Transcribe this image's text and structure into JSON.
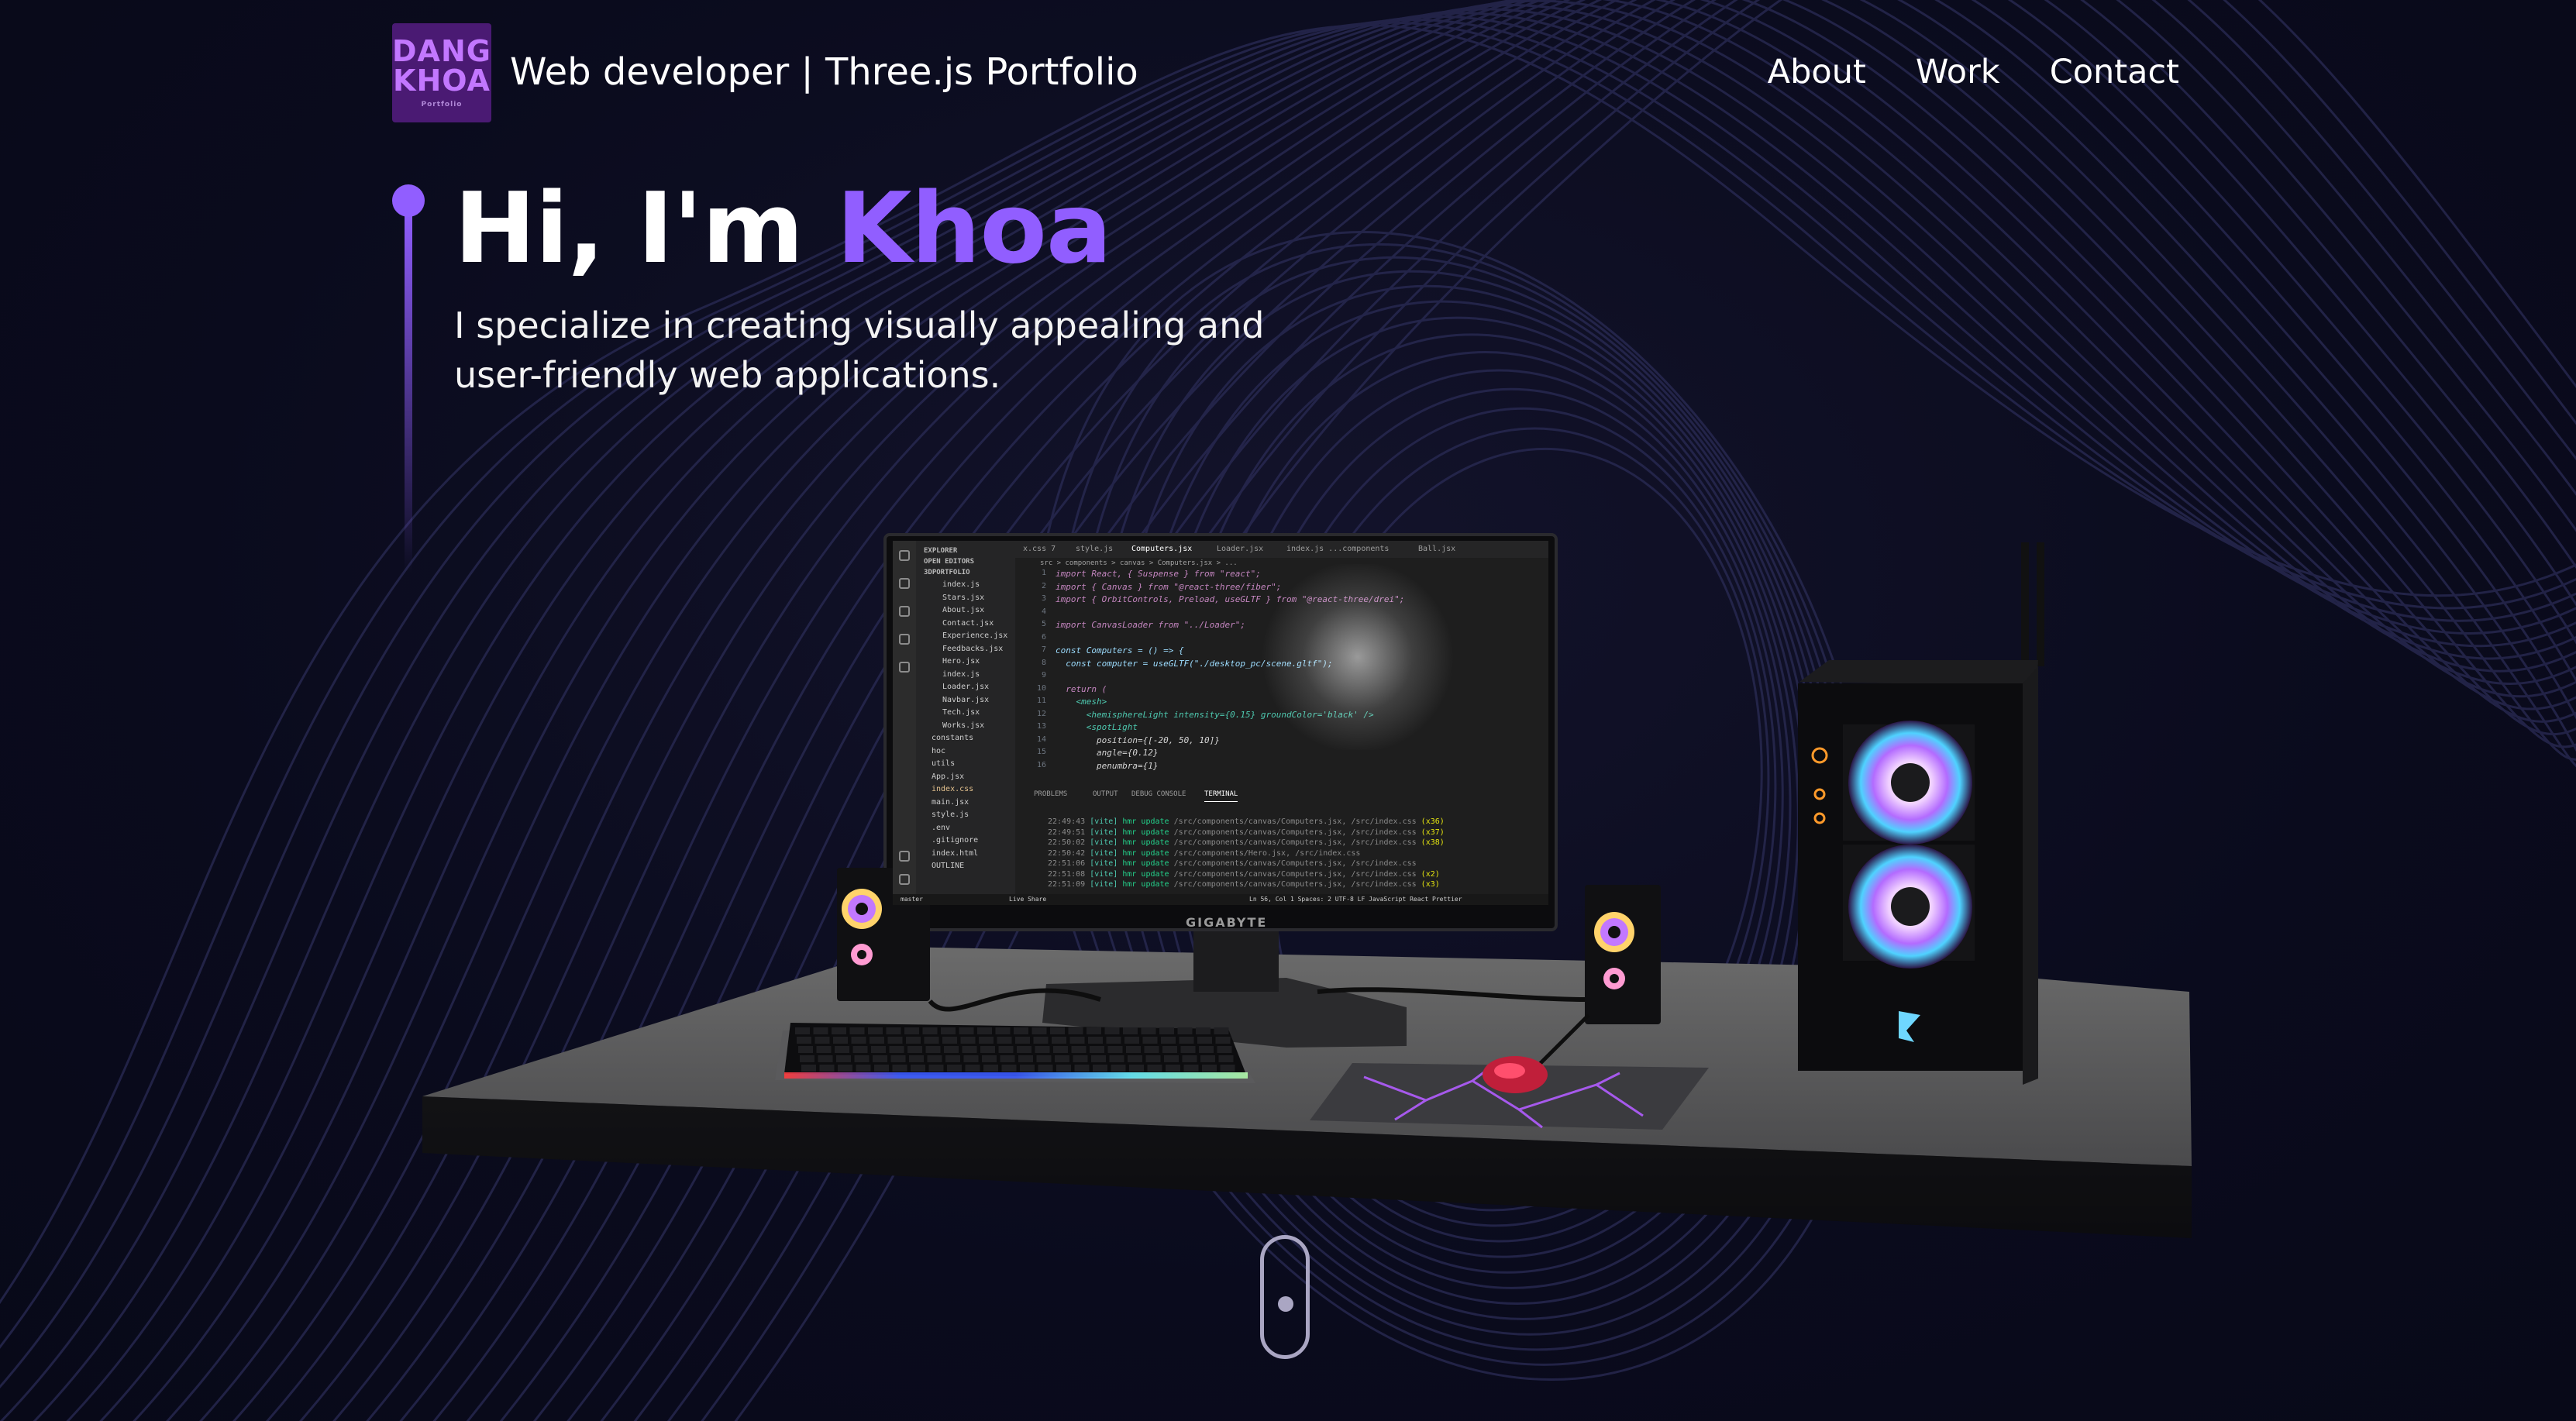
{
  "navbar": {
    "logo_line1": "DANG",
    "logo_line2": "KHOA",
    "logo_small": "Portfolio",
    "site_title": "Web developer | Three.js Portfolio",
    "links": [
      {
        "label": "About"
      },
      {
        "label": "Work"
      },
      {
        "label": "Contact"
      }
    ]
  },
  "hero": {
    "greeting": "Hi, I'm ",
    "name": "Khoa",
    "subtitle": "I specialize in creating visually appealing and user-friendly web applications."
  },
  "scene": {
    "monitor_brand": "GIGABYTE",
    "editor": {
      "tabs": [
        {
          "label": "x.css 7",
          "active": false
        },
        {
          "label": "style.js",
          "active": false
        },
        {
          "label": "Computers.jsx",
          "active": true
        },
        {
          "label": "Loader.jsx",
          "active": false
        },
        {
          "label": "index.js ...components",
          "active": false
        },
        {
          "label": "Ball.jsx",
          "active": false
        }
      ],
      "breadcrumb": "src > components > canvas > Computers.jsx > ...",
      "explorer_header": "EXPLORER",
      "open_editors": "OPEN EDITORS",
      "project": "3DPORTFOLIO",
      "files": [
        "index.js",
        "Stars.jsx",
        "About.jsx",
        "Contact.jsx",
        "Experience.jsx",
        "Feedbacks.jsx",
        "Hero.jsx",
        "index.js",
        "Loader.jsx",
        "Navbar.jsx",
        "Tech.jsx",
        "Works.jsx",
        "constants",
        "hoc",
        "utils",
        "App.jsx",
        "index.css",
        "main.jsx",
        "style.js",
        ".env",
        ".gitignore",
        "index.html",
        "OUTLINE"
      ],
      "code_lines": [
        {
          "n": "1",
          "text": "import React, { Suspense } from \"react\";"
        },
        {
          "n": "2",
          "text": "import { Canvas } from \"@react-three/fiber\";"
        },
        {
          "n": "3",
          "text": "import { OrbitControls, Preload, useGLTF } from \"@react-three/drei\";"
        },
        {
          "n": "4",
          "text": ""
        },
        {
          "n": "5",
          "text": "import CanvasLoader from \"../Loader\";"
        },
        {
          "n": "6",
          "text": ""
        },
        {
          "n": "7",
          "text": "const Computers = () => {"
        },
        {
          "n": "8",
          "text": "  const computer = useGLTF(\"./desktop_pc/scene.gltf\");"
        },
        {
          "n": "9",
          "text": ""
        },
        {
          "n": "10",
          "text": "  return ("
        },
        {
          "n": "11",
          "text": "    <mesh>"
        },
        {
          "n": "12",
          "text": "      <hemisphereLight intensity={0.15} groundColor='black' />"
        },
        {
          "n": "13",
          "text": "      <spotLight"
        },
        {
          "n": "14",
          "text": "        position={[-20, 50, 10]}"
        },
        {
          "n": "15",
          "text": "        angle={0.12}"
        },
        {
          "n": "16",
          "text": "        penumbra={1}"
        }
      ],
      "panel_tabs": [
        {
          "label": "PROBLEMS",
          "active": false
        },
        {
          "label": "OUTPUT",
          "active": false
        },
        {
          "label": "DEBUG CONSOLE",
          "active": false
        },
        {
          "label": "TERMINAL",
          "active": true
        }
      ],
      "terminal_lines": [
        {
          "time": "22:49:43",
          "path": "/src/components/canvas/Computers.jsx, /src/index.css",
          "count": "(x36)"
        },
        {
          "time": "22:49:51",
          "path": "/src/components/canvas/Computers.jsx, /src/index.css",
          "count": "(x37)"
        },
        {
          "time": "22:50:02",
          "path": "/src/components/canvas/Computers.jsx, /src/index.css",
          "count": "(x38)"
        },
        {
          "time": "22:50:42",
          "path": "/src/components/Hero.jsx, /src/index.css",
          "count": ""
        },
        {
          "time": "22:51:06",
          "path": "/src/components/canvas/Computers.jsx, /src/index.css",
          "count": ""
        },
        {
          "time": "22:51:08",
          "path": "/src/components/canvas/Computers.jsx, /src/index.css",
          "count": "(x2)"
        },
        {
          "time": "22:51:09",
          "path": "/src/components/canvas/Computers.jsx, /src/index.css",
          "count": "(x3)"
        }
      ],
      "term_tag": "[vite]",
      "term_msg": "hmr update",
      "status_left": "master",
      "status_live": "Live Share",
      "status_right": "Ln 56, Col 1   Spaces: 2   UTF-8   LF   JavaScript React   Prettier"
    }
  },
  "colors": {
    "accent": "#915eff",
    "background": "#0a0b1d",
    "logo_bg": "#4a1a73"
  }
}
